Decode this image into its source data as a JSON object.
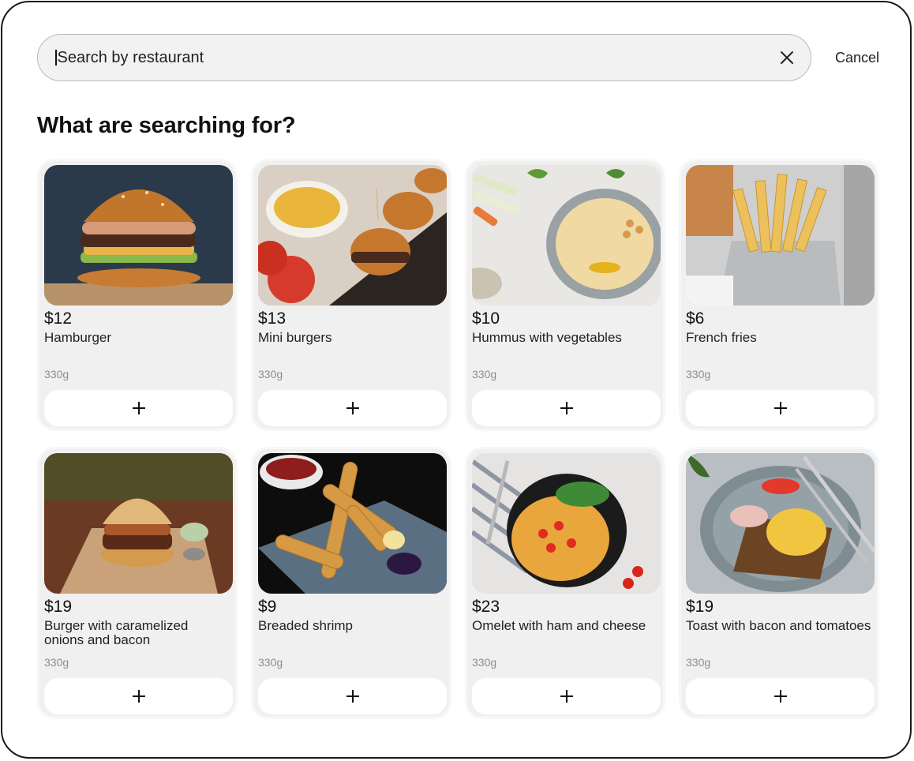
{
  "search": {
    "placeholder": "Search by restaurant",
    "clear_icon": "close-icon",
    "cancel_label": "Cancel"
  },
  "heading": "What are searching for?",
  "items": [
    {
      "price": "$12",
      "name": "Hamburger",
      "weight": "330g",
      "add_icon": "plus-icon"
    },
    {
      "price": "$13",
      "name": "Mini burgers",
      "weight": "330g",
      "add_icon": "plus-icon"
    },
    {
      "price": "$10",
      "name": "Hummus with vegetables",
      "weight": "330g",
      "add_icon": "plus-icon"
    },
    {
      "price": "$6",
      "name": "French fries",
      "weight": "330g",
      "add_icon": "plus-icon"
    },
    {
      "price": "$19",
      "name": "Burger with caramelized onions and bacon",
      "weight": "330g",
      "add_icon": "plus-icon"
    },
    {
      "price": "$9",
      "name": "Breaded shrimp",
      "weight": "330g",
      "add_icon": "plus-icon"
    },
    {
      "price": "$23",
      "name": "Omelet with ham and cheese",
      "weight": "330g",
      "add_icon": "plus-icon"
    },
    {
      "price": "$19",
      "name": "Toast with bacon and tomatoes",
      "weight": "330g",
      "add_icon": "plus-icon"
    }
  ],
  "colors": {
    "card_bg": "#f0f0f0",
    "search_bg": "#f2f2f2",
    "text": "#111111",
    "muted": "#8d8d8d"
  }
}
